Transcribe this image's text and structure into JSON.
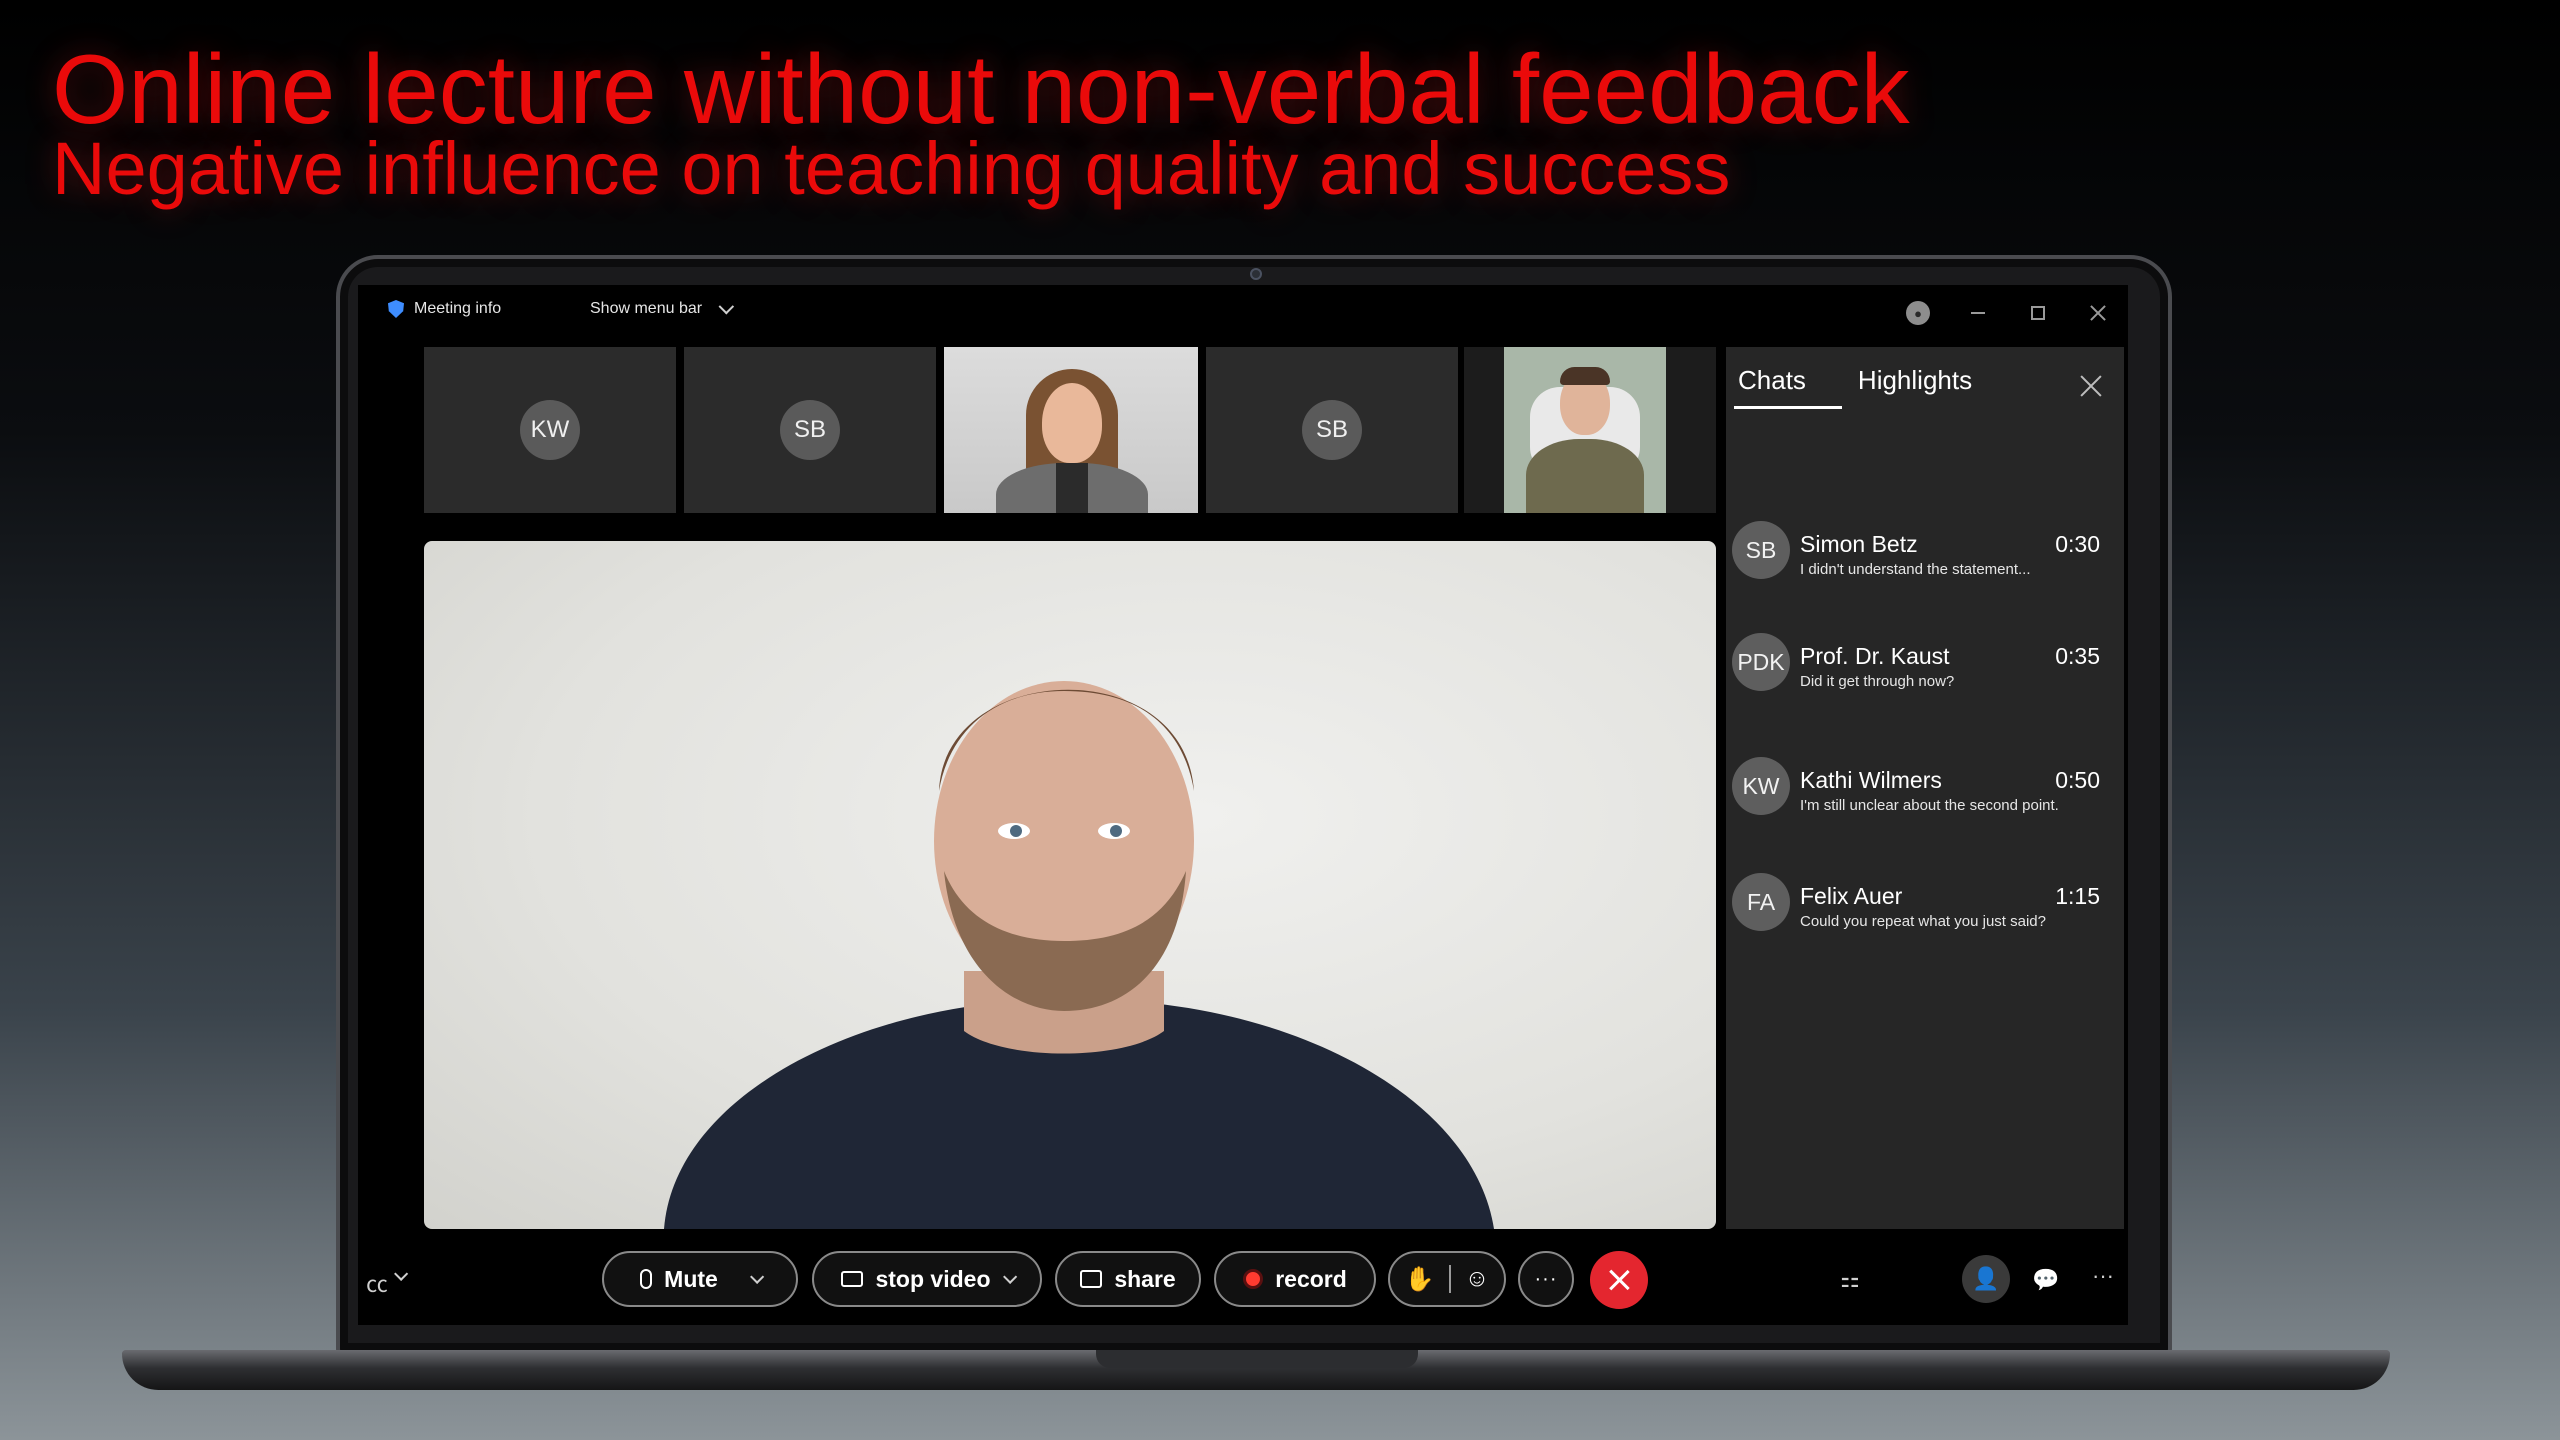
{
  "slide": {
    "title": "Online lecture without non-verbal feedback",
    "subtitle": "Negative influence on teaching quality and success"
  },
  "topbar": {
    "meeting_info": "Meeting info",
    "menu_bar": "Show menu bar"
  },
  "thumbnails": [
    {
      "initials": "KW"
    },
    {
      "initials": "SB"
    },
    {
      "initials": ""
    },
    {
      "initials": "SB"
    },
    {
      "initials": ""
    }
  ],
  "chat_panel": {
    "tabs": [
      {
        "label": "Chats",
        "active": true
      },
      {
        "label": "Highlights",
        "active": false
      }
    ],
    "messages": [
      {
        "initials": "SB",
        "name": "Simon Betz",
        "time": "0:30",
        "text": "I didn't understand the statement..."
      },
      {
        "initials": "PDK",
        "name": "Prof. Dr. Kaust",
        "time": "0:35",
        "text": "Did it get through now?"
      },
      {
        "initials": "KW",
        "name": "Kathi Wilmers",
        "time": "0:50",
        "text": "I'm still unclear about the second point."
      },
      {
        "initials": "FA",
        "name": "Felix Auer",
        "time": "1:15",
        "text": "Could you repeat what you just said?"
      }
    ]
  },
  "toolbar": {
    "mute_label": "Mute",
    "video_label": "stop video",
    "share_label": "share",
    "record_label": "record",
    "more_label": "···"
  },
  "colors": {
    "accent_red": "#ea0a0a",
    "end_call": "#e4262f",
    "panel_bg": "#262626"
  }
}
